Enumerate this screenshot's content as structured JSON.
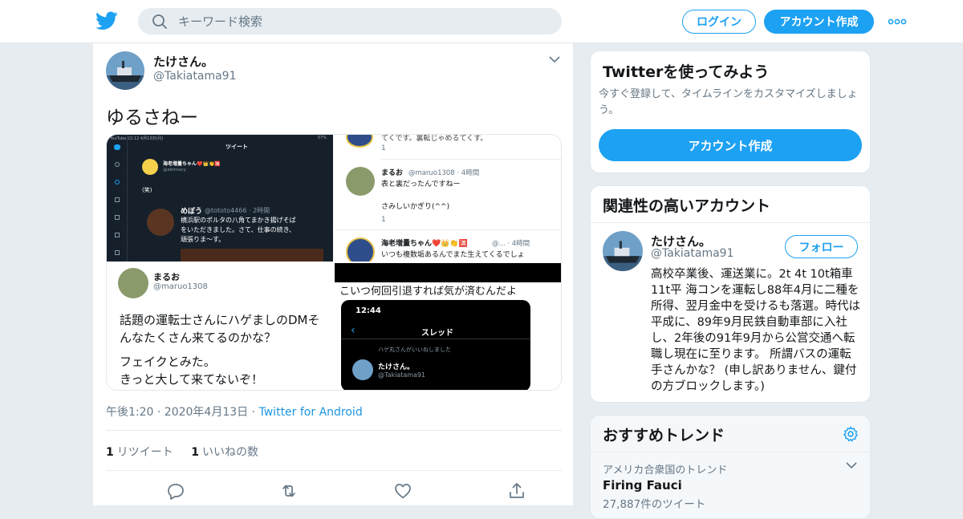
{
  "header": {
    "search_placeholder": "キーワード検索",
    "login_label": "ログイン",
    "signup_label": "アカウント作成"
  },
  "tweet": {
    "author_name": "たけさん。",
    "author_handle": "@Takiatama91",
    "text": "ゆるさねー",
    "timestamp": "午後1:20 · 2020年4月13日",
    "source_sep": " · ",
    "source": "Twitter for Android",
    "retweets_count": "1",
    "retweets_label": "リツイート",
    "likes_count": "1",
    "likes_label": "いいねの数"
  },
  "media": {
    "top_left": {
      "status_left": "YouTube 22:12  4月13日(月)",
      "status_right": "57%",
      "header": "ツイート",
      "user": "海老増量ちゃん❤️👑👏🈵",
      "user_handle": "@ebimacy",
      "body": "(笑)",
      "reply_user": "めぼう",
      "reply_handle": "@tototo4466 · 2時間",
      "reply_text_1": "横浜駅のポルタの八角てまかき揚げそば",
      "reply_text_2": "をいただきました。さて、仕事の続き、",
      "reply_text_3": "頑張りま〜す。"
    },
    "top_right": {
      "line_top": "てくです。裏転じゃめるてくす。",
      "count_a": "1",
      "user": "まるお",
      "user_meta": "@maruo1308 · 4時間",
      "text_1": "表と裏だったんですねー",
      "text_2": "さみしいかぎり(^^)",
      "count_b": "1",
      "user2": "海老増量ちゃん❤️👑👏🈵",
      "user2_meta": "@... · 4時間",
      "text_3": "いつも複数垢あるんでまた生えてくるでしょ"
    },
    "bottom_left": {
      "user": "まるお",
      "handle": "@maruo1308",
      "text_1": "話題の運転士さんにハゲましのDMそ",
      "text_2": "んなたくさん来てるのかな？",
      "text_3": "フェイクとみた。",
      "text_4": "きっと大して来てないぞ！"
    },
    "bottom_right": {
      "caption": "こいつ何回引退すれば気が済むんだよ",
      "time": "12:44",
      "header": "スレッド",
      "liked_line": "ハゲ丸さんがいいねしました",
      "user": "たけさん。",
      "handle": "@Takiatama91"
    }
  },
  "sidebar": {
    "signup_card": {
      "title": "Twitterを使ってみよう",
      "desc": "今すぐ登録して、タイムラインをカスタマイズしましょう。",
      "button": "アカウント作成"
    },
    "related_card": {
      "title": "関連性の高いアカウント",
      "name": "たけさん。",
      "handle": "@Takiatama91",
      "follow_label": "フォロー",
      "bio": "高校卒業後、運送業に。2t 4t 10t箱車 11t平 海コンを運転し88年4月に二種を所得、翌月金中を受けるも落選。時代は平成に、89年9月民鉄自動車部に入社し、2年後の91年9月から公営交通へ転職し現在に至ります。 所謂バスの運転手さんかな？ (申し訳ありません、鍵付の方ブロックします。)"
    },
    "trends_card": {
      "title": "おすすめトレンド",
      "context": "アメリカ合衆国のトレンド",
      "name": "Firing Fauci",
      "count": "27,887件のツイート"
    }
  },
  "colors": {
    "accent": "#1da1f2",
    "background": "#e6ecf0",
    "secondary_text": "#657786"
  },
  "icons": [
    "twitter-bird-icon",
    "search-icon",
    "more-icon",
    "chevron-down-icon",
    "reply-icon",
    "retweet-icon",
    "like-icon",
    "share-icon",
    "gear-icon"
  ]
}
